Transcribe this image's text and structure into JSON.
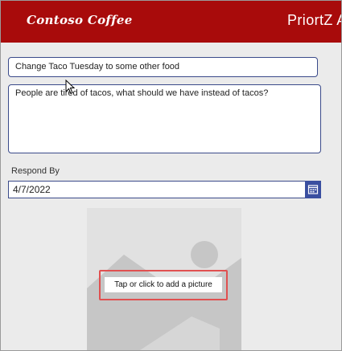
{
  "header": {
    "brand": "Contoso Coffee",
    "app_title": "PriortZ A"
  },
  "form": {
    "title_value": "Change Taco Tuesday to some other food",
    "description_value": "People are tired of tacos, what should we have instead of tacos?",
    "respond_by_label": "Respond By",
    "respond_by_value": "4/7/2022",
    "picture_prompt": "Tap or click to add a picture"
  },
  "icons": {
    "calendar": "calendar-icon",
    "picture_placeholder": "image-placeholder-icon",
    "cursor": "mouse-pointer-icon"
  },
  "colors": {
    "header_bg": "#a80b0b",
    "accent_blue": "#3a4fa0",
    "highlight_red": "#e05050"
  }
}
